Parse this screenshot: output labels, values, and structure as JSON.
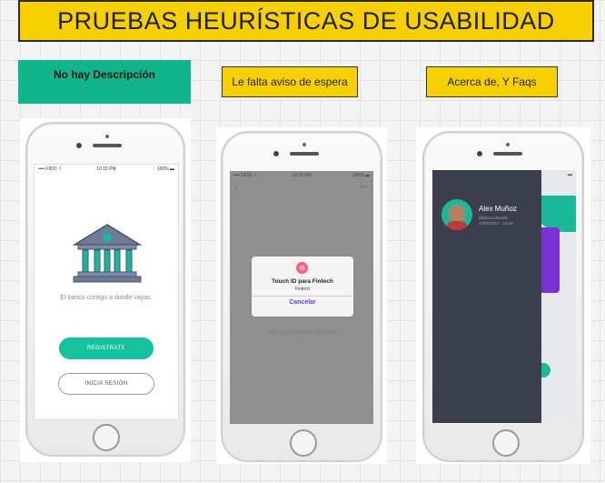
{
  "title": "PRUEBAS HEURÍSTICAS DE USABILIDAD",
  "labels": {
    "first": "No hay Descripción",
    "second": "Le falta aviso de espera",
    "third": "Acerca de, Y Faqs"
  },
  "phone1": {
    "status": {
      "carrier": "•••• FIDO ⌔",
      "time": "10:15 PM",
      "battery": "100% ▬"
    },
    "tagline": "El banco contigo a donde vayas.",
    "register_label": "REGISTRATE",
    "login_label": "INICIA SESIÓN",
    "icon": "bank-icon",
    "colors": {
      "accent": "#15c2a0",
      "bank_fill": "#6d7b97",
      "bank_dot": "#17b99a"
    }
  },
  "phone2": {
    "status": {
      "carrier": "•••• FIDO ⌔",
      "time": "10:15 PM",
      "battery": "100% ▬"
    },
    "dialog_title": "Touch ID para Fintech",
    "dialog_subtitle": "Fintech",
    "dialog_cancel": "Cancelar",
    "hint": "Toca para registrar tu huella",
    "icon": "fingerprint-icon",
    "colors": {
      "overlay": "#8f8f8f",
      "cancel": "#6a3fd0",
      "fingerprint": "#ff5c7a"
    }
  },
  "phone3": {
    "user_name": "Alex Muñoz",
    "user_detail_1": "Última conexión",
    "user_detail_2": "27/07/2017 - 10:15",
    "icon": "avatar",
    "colors": {
      "drawer": "#3b3f4b",
      "purple": "#7b2fd6",
      "teal": "#19b99a"
    }
  }
}
